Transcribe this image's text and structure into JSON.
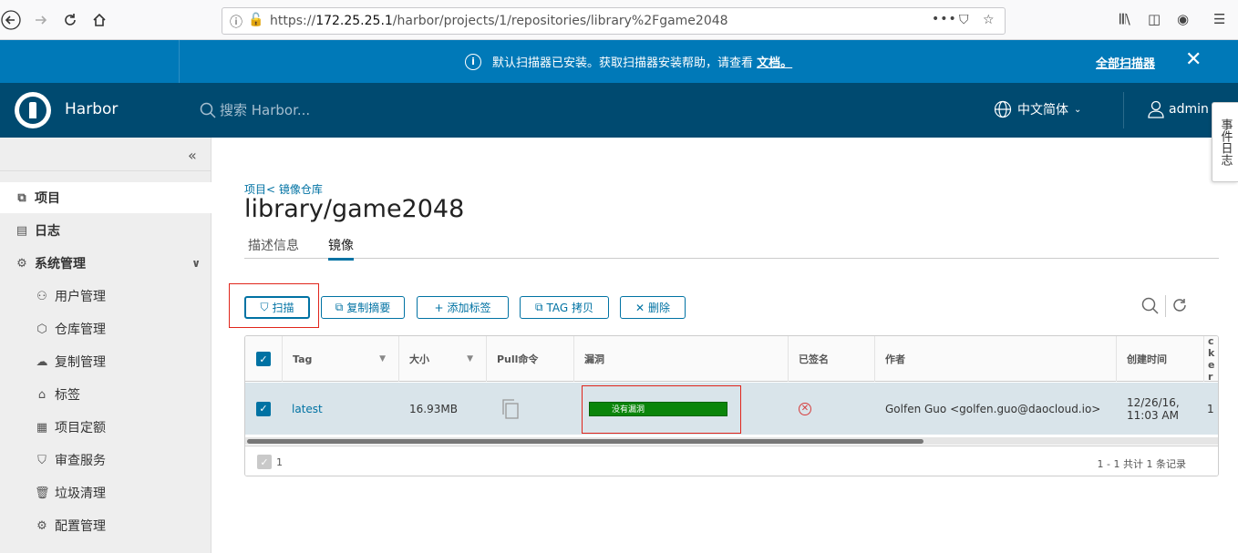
{
  "browser": {
    "url_prefix": "https://",
    "url_host": "172.25.25.1",
    "url_path": "/harbor/projects/1/repositories/library%2Fgame2048",
    "url_menu": "•••"
  },
  "banner": {
    "message": "默认扫描器已安装。获取扫描器安装帮助，请查看",
    "link": "文档。",
    "all_scanners": "全部扫描器",
    "close": "✕"
  },
  "header": {
    "brand": "Harbor",
    "search_placeholder": "搜索 Harbor...",
    "language": "中文简体",
    "user": "admin",
    "event_log": "事件日志"
  },
  "sidebar": {
    "collapse": "«",
    "items": [
      {
        "label": "项目",
        "icon": "project-icon",
        "glyph": "⧉"
      },
      {
        "label": "日志",
        "icon": "log-icon",
        "glyph": "▤"
      },
      {
        "label": "系统管理",
        "icon": "admin-icon",
        "glyph": "⚙"
      },
      {
        "label": "用户管理",
        "icon": "users-icon",
        "glyph": "⚇"
      },
      {
        "label": "仓库管理",
        "icon": "registry-icon",
        "glyph": "⬡"
      },
      {
        "label": "复制管理",
        "icon": "replication-icon",
        "glyph": "☁"
      },
      {
        "label": "标签",
        "icon": "tag-icon",
        "glyph": "⌂"
      },
      {
        "label": "项目定额",
        "icon": "quota-icon",
        "glyph": "▦"
      },
      {
        "label": "审查服务",
        "icon": "shield-icon",
        "glyph": "⛉"
      },
      {
        "label": "垃圾清理",
        "icon": "trash-icon",
        "glyph": "🗑"
      },
      {
        "label": "配置管理",
        "icon": "config-icon",
        "glyph": "⚙"
      }
    ]
  },
  "main": {
    "breadcrumb": "项目< 镜像仓库",
    "title": "library/game2048",
    "tabs": [
      "描述信息",
      "镜像"
    ],
    "toolbar": {
      "scan": "扫描",
      "copy_digest": "复制摘要",
      "add_label": "添加标签",
      "tag_copy": "TAG 拷贝",
      "delete": "删除"
    },
    "columns": [
      "Tag",
      "大小",
      "Pull命令",
      "漏洞",
      "已签名",
      "作者",
      "创建时间",
      "Docker 版本"
    ],
    "rows": [
      {
        "tag": "latest",
        "size": "16.93MB",
        "vulnerability": "没有漏洞",
        "author": "Golfen Guo <golfen.guo@daocloud.io>",
        "created_line1": "12/26/16,",
        "created_line2": "11:03 AM",
        "docker_version": "1"
      }
    ],
    "footer": {
      "selected": "1",
      "summary": "1 - 1 共计 1 条记录"
    }
  },
  "colors": {
    "banner": "#0079b8",
    "header": "#004a70",
    "accent": "#0072a3",
    "vuln_ok": "#0a850a",
    "highlight": "#e0251b"
  }
}
